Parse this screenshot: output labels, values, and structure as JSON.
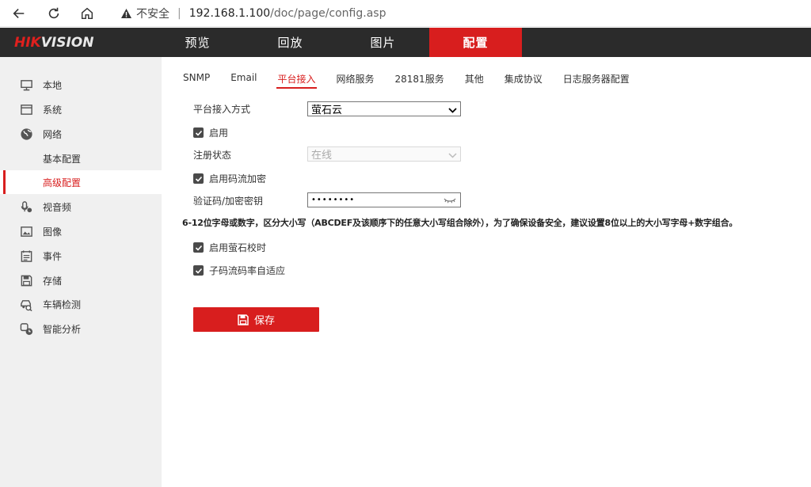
{
  "browser": {
    "security_warning": "不安全",
    "url_host": "192.168.1.100",
    "url_path": "/doc/page/config.asp"
  },
  "brand": {
    "hik": "HIK",
    "vision": "VISION",
    "accent_color": "#d81e1e"
  },
  "top_nav": [
    {
      "label": "预览",
      "active": false
    },
    {
      "label": "回放",
      "active": false
    },
    {
      "label": "图片",
      "active": false
    },
    {
      "label": "配置",
      "active": true
    }
  ],
  "sidebar": [
    {
      "label": "本地",
      "icon": "monitor-icon"
    },
    {
      "label": "系统",
      "icon": "window-icon"
    },
    {
      "label": "网络",
      "icon": "globe-icon"
    },
    {
      "label": "基本配置",
      "sub": true
    },
    {
      "label": "高级配置",
      "sub": true,
      "active": true
    },
    {
      "label": "视音频",
      "icon": "mic-icon"
    },
    {
      "label": "图像",
      "icon": "image-icon"
    },
    {
      "label": "事件",
      "icon": "event-icon"
    },
    {
      "label": "存储",
      "icon": "save-icon"
    },
    {
      "label": "车辆检测",
      "icon": "vehicle-icon"
    },
    {
      "label": "智能分析",
      "icon": "smart-icon"
    }
  ],
  "tabs": [
    {
      "label": "SNMP"
    },
    {
      "label": "Email"
    },
    {
      "label": "平台接入",
      "active": true
    },
    {
      "label": "网络服务"
    },
    {
      "label": "28181服务"
    },
    {
      "label": "其他"
    },
    {
      "label": "集成协议"
    },
    {
      "label": "日志服务器配置"
    }
  ],
  "form": {
    "access_mode_label": "平台接入方式",
    "access_mode_value": "萤石云",
    "enable_label": "启用",
    "reg_status_label": "注册状态",
    "reg_status_value": "在线",
    "stream_encrypt_label": "启用码流加密",
    "key_label": "验证码/加密密钥",
    "key_value": "••••••••",
    "hint": "6-12位字母或数字，区分大小写（ABCDEF及该顺序下的任意大小写组合除外），为了确保设备安全，建议设置8位以上的大小写字母+数字组合。",
    "timesync_label": "启用萤石校时",
    "adaptive_label": "子码流码率自适应",
    "save_label": "保存"
  }
}
